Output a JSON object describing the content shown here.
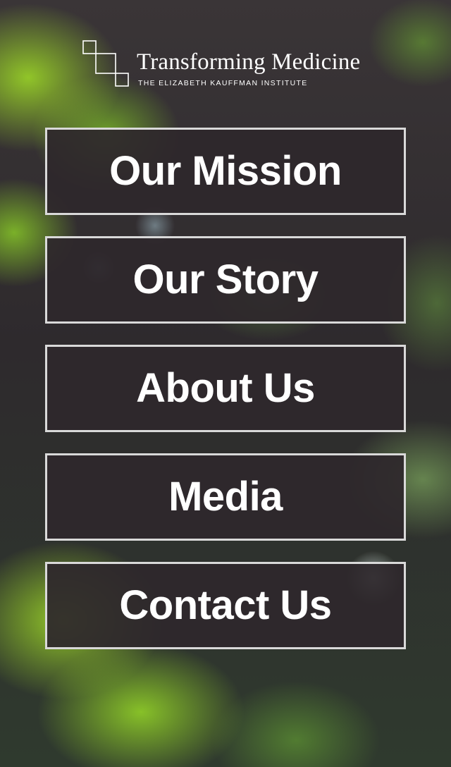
{
  "brand": {
    "title": "Transforming Medicine",
    "subtitle": "THE ELIZABETH KAUFFMAN INSTITUTE",
    "mark_icon": "stacked-squares-logo-icon"
  },
  "nav": {
    "items": [
      {
        "label": "Our Mission"
      },
      {
        "label": "Our Story"
      },
      {
        "label": "About Us"
      },
      {
        "label": "Media"
      },
      {
        "label": "Contact Us"
      }
    ]
  },
  "colors": {
    "button_border": "#d9d9d9",
    "button_fill": "#2e282c",
    "text": "#ffffff",
    "accent_green": "#96cd28"
  }
}
